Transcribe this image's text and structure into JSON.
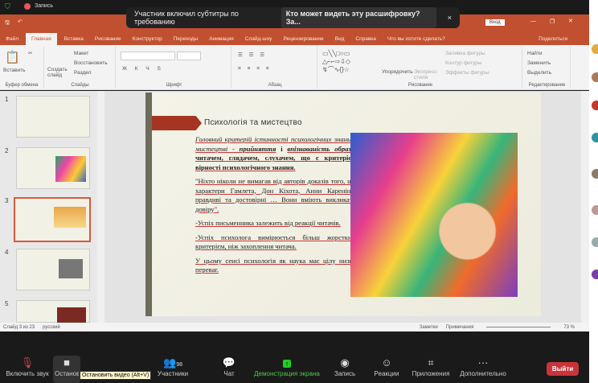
{
  "zoom": {
    "recording_label": "Запись",
    "notification": "Участник включил субтитры по требованию",
    "notification_link": "Кто может видеть эту расшифровку? За...",
    "close": "×",
    "toolbar": [
      {
        "label": "Включить звук",
        "icon": "mic-muted-icon"
      },
      {
        "label": "Остановить видео",
        "icon": "video-icon"
      },
      {
        "label": "Участники",
        "icon": "participants-icon",
        "count": "98"
      },
      {
        "label": "Чат",
        "icon": "chat-icon"
      },
      {
        "label": "Демонстрация экрана",
        "icon": "share-screen-icon"
      },
      {
        "label": "Запись",
        "icon": "record-icon"
      },
      {
        "label": "Реакции",
        "icon": "reactions-icon"
      },
      {
        "label": "Приложения",
        "icon": "apps-icon"
      },
      {
        "label": "Дополнительно",
        "icon": "more-icon"
      }
    ],
    "tooltip": "Остановить видео (Alt+V)",
    "leave": "Выйти"
  },
  "ppt": {
    "signin": "Вход",
    "share": "Поделиться",
    "tabs": [
      "Файл",
      "Главная",
      "Вставка",
      "Рисование",
      "Конструктор",
      "Переходы",
      "Анимация",
      "Слайд-шоу",
      "Рецензирование",
      "Вид",
      "Справка"
    ],
    "tell_me": "Что вы хотите сделать?",
    "ribbon": {
      "paste": "Вставить",
      "clipboard": "Буфер обмена",
      "new_slide": "Создать слайд",
      "layout": "Макет",
      "reset": "Восстановить",
      "section": "Раздел",
      "slides": "Слайды",
      "font": "Шрифт",
      "paragraph": "Абзац",
      "arrange": "Упорядочить",
      "quick_styles": "Экспресс-стили",
      "fill": "Заливка фигуры",
      "outline": "Контур фигуры",
      "effects": "Эффекты фигуры",
      "drawing": "Рисование",
      "find": "Найти",
      "replace": "Заменить",
      "select": "Выделить",
      "editing": "Редактирование"
    },
    "thumbs": [
      "1",
      "2",
      "3",
      "4",
      "5"
    ],
    "status": {
      "slide": "Слайд 3 из 23",
      "lang": "русский",
      "notes": "Заметки",
      "comments": "Примечания",
      "zoom": "73 %"
    }
  },
  "slide": {
    "title": "Психологія та мистецтво",
    "p1a": "Головний критерій істинності психологічних знань в мистецтві - ",
    "p1b": "прийняття",
    "p1c": " і ",
    "p1d": "впізнаваність образів",
    "p1e": " читачем, глядачем, слухачем, що є критерієм вірності психологічного знання.",
    "p2": "\"Ніхто ніколи не вимагав від авторів доказів того, що характери Гамлета, Дон Кіхота, Анни Кареніної правдиві та достовірні … Вони вміють викликати довіру\".",
    "p3": "-Успіх письменника залежить від реакції читачів.",
    "p4": "-Успіх психолога вимірюється більш жорстким критерієм, ніж захоплення читача.",
    "p5": "У цьому сенсі психологія як наука має цілу низку переваг."
  }
}
